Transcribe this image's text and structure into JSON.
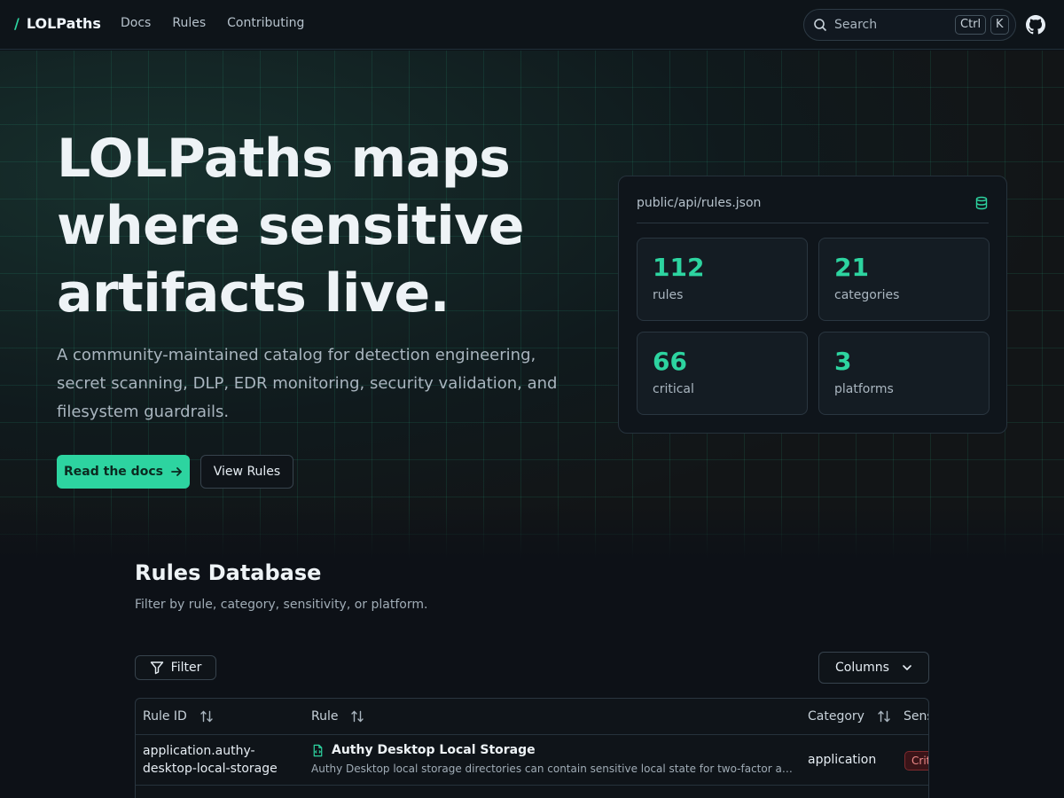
{
  "header": {
    "brand_slash": "/",
    "brand": "LOLPaths",
    "nav": [
      "Docs",
      "Rules",
      "Contributing"
    ],
    "search_label": "Search",
    "search_key_ctrl": "Ctrl",
    "search_key_k": "K"
  },
  "hero": {
    "title": "LOLPaths maps where sensitive artifacts live.",
    "subtitle": "A community-maintained catalog for detection engineering, secret scanning, DLP, EDR monitoring, security validation, and filesystem guardrails.",
    "primary_cta": "Read the docs",
    "secondary_cta": "View Rules"
  },
  "stats": {
    "path": "public/api/rules.json",
    "items": [
      {
        "value": "112",
        "label": "rules"
      },
      {
        "value": "21",
        "label": "categories"
      },
      {
        "value": "66",
        "label": "critical"
      },
      {
        "value": "3",
        "label": "platforms"
      }
    ]
  },
  "rules": {
    "title": "Rules Database",
    "subtitle": "Filter by rule, category, sensitivity, or platform.",
    "filter_label": "Filter",
    "columns_label": "Columns",
    "headers": [
      "Rule ID",
      "Rule",
      "Category",
      "Sens"
    ],
    "rows": [
      {
        "id": "application.authy-desktop-local-storage",
        "name": "Authy Desktop Local Storage",
        "description": "Authy Desktop local storage directories can contain sensitive local state for two-factor authenti...",
        "category": "application",
        "sensitivity": "Crit"
      }
    ]
  },
  "colors": {
    "accent": "#2dd4a0",
    "background": "#0d1117",
    "critical_text": "#f08b8b"
  }
}
